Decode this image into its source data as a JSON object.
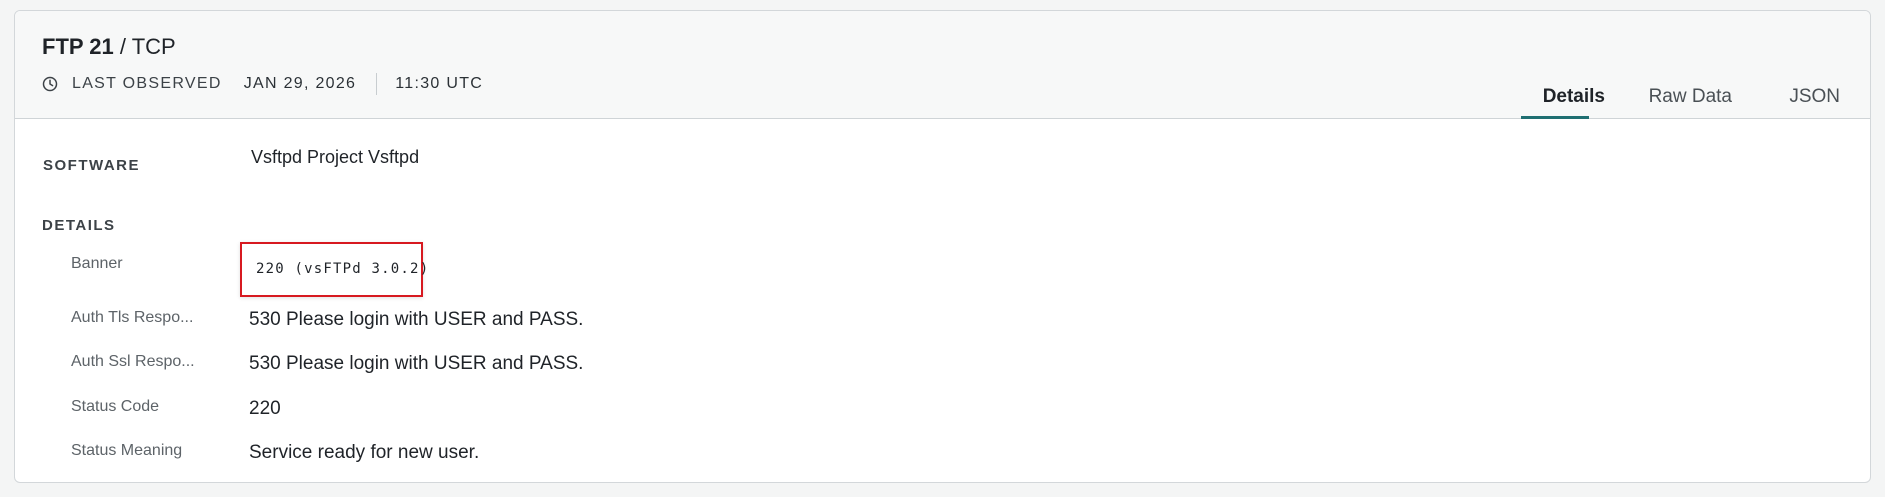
{
  "service": {
    "name": "FTP 21",
    "separator": " / ",
    "protocol": "TCP"
  },
  "observed": {
    "label": "LAST OBSERVED",
    "date": "JAN 29, 2026",
    "time": "11:30 UTC",
    "icon": "clock-icon"
  },
  "tabs": [
    {
      "label": "Details",
      "active": true
    },
    {
      "label": "Raw Data",
      "active": false
    },
    {
      "label": "JSON",
      "active": false
    }
  ],
  "software": {
    "label": "SOFTWARE",
    "value": "Vsftpd Project Vsftpd"
  },
  "details": {
    "label": "DETAILS",
    "fields": [
      {
        "label": "Banner",
        "value": "220 (vsFTPd 3.0.2)"
      },
      {
        "label": "Auth Tls Respo...",
        "value": "530 Please login with USER and PASS."
      },
      {
        "label": "Auth Ssl Respo...",
        "value": "530 Please login with USER and PASS."
      },
      {
        "label": "Status Code",
        "value": "220"
      },
      {
        "label": "Status Meaning",
        "value": "Service ready for new user."
      }
    ]
  },
  "colors": {
    "accent": "#1f6f72",
    "highlight_border": "#d71920"
  }
}
